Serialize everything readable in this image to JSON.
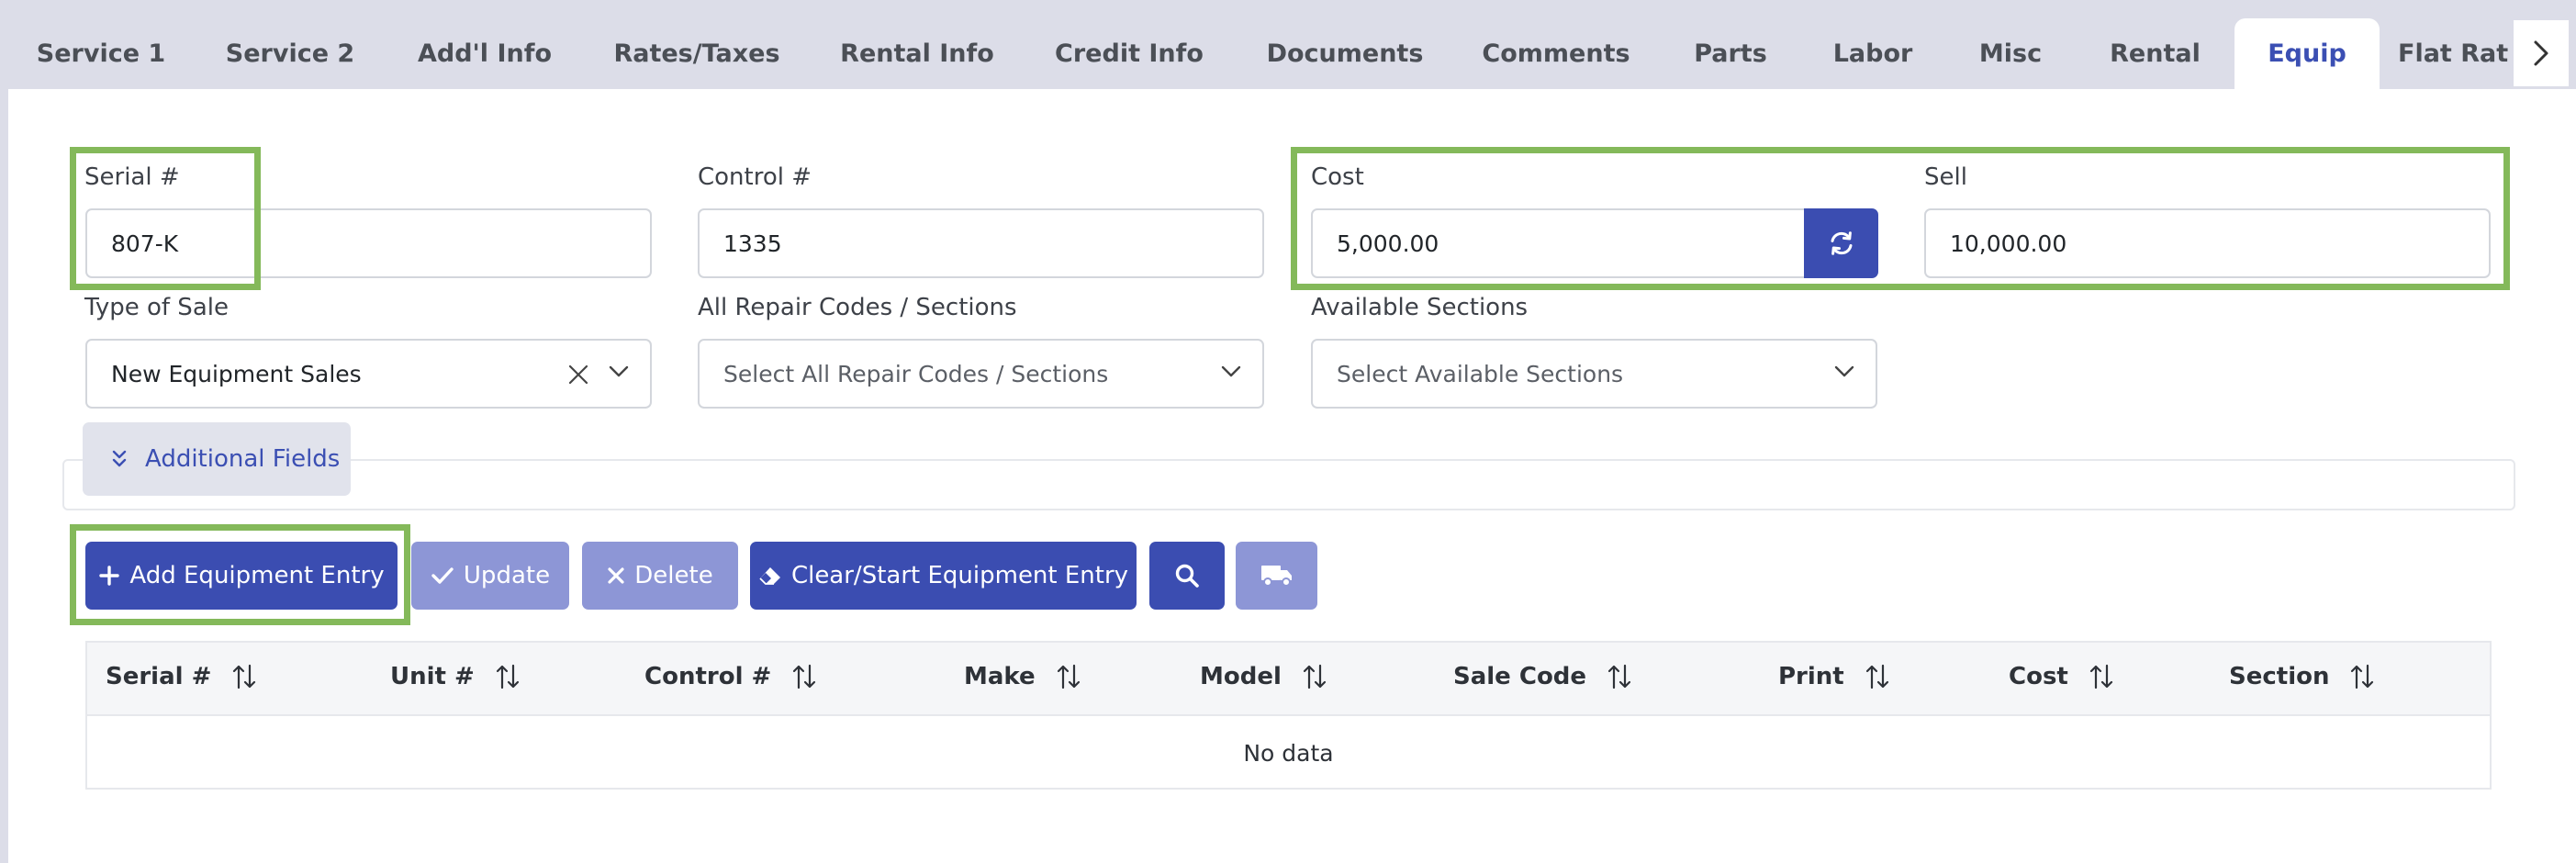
{
  "tabs": [
    "Service 1",
    "Service 2",
    "Add'l Info",
    "Rates/Taxes",
    "Rental Info",
    "Credit Info",
    "Documents",
    "Comments",
    "Parts",
    "Labor",
    "Misc",
    "Rental",
    "Equip",
    "Flat Rat"
  ],
  "active_tab": "Equip",
  "form": {
    "serial": {
      "label": "Serial #",
      "value": "807-K"
    },
    "control": {
      "label": "Control #",
      "value": "1335"
    },
    "cost": {
      "label": "Cost",
      "value": "5,000.00"
    },
    "sell": {
      "label": "Sell",
      "value": "10,000.00"
    },
    "type_of_sale": {
      "label": "Type of Sale",
      "value": "New Equipment Sales"
    },
    "repair_codes": {
      "label": "All Repair Codes / Sections",
      "placeholder": "Select All Repair Codes / Sections"
    },
    "available_sections": {
      "label": "Available Sections",
      "placeholder": "Select Available Sections"
    }
  },
  "additional_fields_label": "Additional Fields",
  "actions": {
    "add": "Add Equipment Entry",
    "update": "Update",
    "delete": "Delete",
    "clear": "Clear/Start Equipment Entry"
  },
  "table": {
    "columns": [
      "Serial #",
      "Unit #",
      "Control #",
      "Make",
      "Model",
      "Sale Code",
      "Print",
      "Cost",
      "Section"
    ],
    "empty_text": "No data"
  },
  "icons": {
    "refresh": "refresh-icon",
    "search": "search-icon",
    "truck": "truck-icon",
    "plus": "plus-icon",
    "check": "check-icon",
    "x": "x-icon",
    "eraser": "eraser-icon",
    "chevrons": "chevrons-down-icon"
  },
  "colors": {
    "primary": "#3b4db1",
    "muted": "#8d96d6",
    "highlight": "#84b95a",
    "tabbar": "#dcdde8"
  }
}
